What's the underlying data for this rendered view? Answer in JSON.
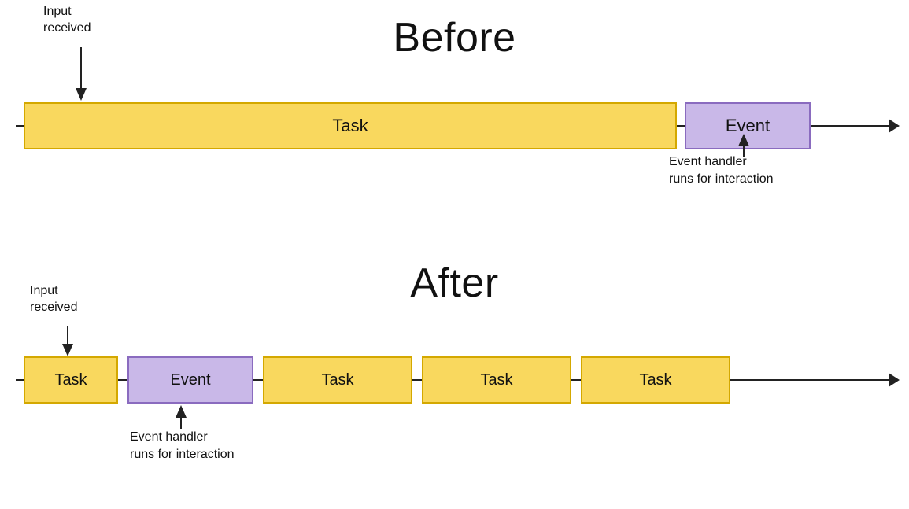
{
  "before": {
    "title": "Before",
    "input_received_label": "Input\nreceived",
    "task_label": "Task",
    "event_label": "Event",
    "event_handler_label": "Event handler\nruns for interaction"
  },
  "after": {
    "title": "After",
    "input_received_label": "Input\nreceived",
    "task_label": "Task",
    "event_label": "Event",
    "event_handler_label": "Event handler\nruns for interaction",
    "task2_label": "Task",
    "task3_label": "Task",
    "task4_label": "Task"
  },
  "colors": {
    "task_bg": "#f9d85e",
    "task_border": "#d4a800",
    "event_bg": "#c9b8e8",
    "event_border": "#8a6bbf",
    "line": "#222222",
    "text": "#111111"
  }
}
